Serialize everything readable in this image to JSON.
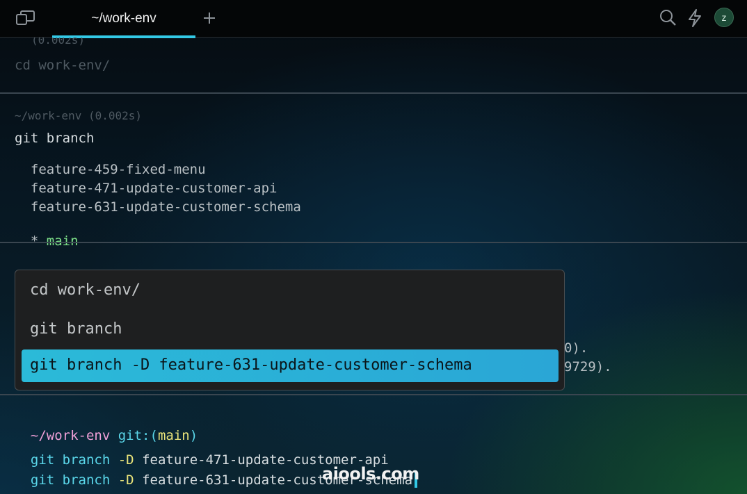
{
  "tabs": {
    "active_label": "~/work-env"
  },
  "icons": {
    "panel": "sidebar-toggle-icon",
    "new_tab": "plus-icon",
    "search": "search-icon",
    "workflows": "lightning-icon"
  },
  "avatar": {
    "initial": "z"
  },
  "block1": {
    "cut_header": "(0.002s)",
    "command": "cd work-env/"
  },
  "block2": {
    "header": "~/work-env (0.002s)",
    "command": "git branch",
    "branches": [
      "  feature-459-fixed-menu",
      "  feature-471-update-customer-api",
      "  feature-631-update-customer-schema"
    ],
    "current_marker": "* ",
    "current_branch": "main"
  },
  "block3": {
    "output_tail_1": "0).",
    "output_tail_2": "9729)."
  },
  "history_popup": {
    "items": [
      "cd work-env/",
      "git branch"
    ],
    "selected": "git branch -D feature-631-update-customer-schema"
  },
  "prompt": {
    "dir": "~/work-env",
    "git_label": "git:(",
    "branch": "main",
    "git_close": ")",
    "lines": [
      {
        "cmd": "git branch",
        "flag": "-D",
        "arg": "feature-471-update-customer-api"
      },
      {
        "cmd": "git branch",
        "flag": "-D",
        "arg": "feature-631-update-customer-schema"
      }
    ]
  },
  "watermark": "aiools.com",
  "colors": {
    "accent": "#33c9e6",
    "branch_current": "#7fe28a",
    "prompt_dir": "#f0a0d8",
    "prompt_git": "#5bd7ea",
    "flag": "#e9e37a"
  }
}
